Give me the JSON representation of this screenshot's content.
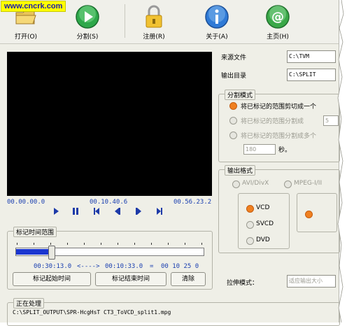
{
  "watermark": "www.cncrk.com",
  "toolbar": {
    "open": "打开(O)",
    "split": "分割(S)",
    "register": "注册(R)",
    "about": "关于(A)",
    "home": "主页(H)"
  },
  "player": {
    "time_start": "00.00.00.0",
    "time_current": "00.10.40.6",
    "time_end": "00.56.23.2"
  },
  "mark_range": {
    "title": "标记时间范围",
    "start": "00:30:13.0",
    "arrow": "<---->",
    "end": "00:10:33.0",
    "equals": "=",
    "duration": "00 10 25 0",
    "btn_mark_start": "标记起始时间",
    "btn_mark_end": "标记结束时间",
    "btn_clear": "清除",
    "position_fraction": 0.19
  },
  "files": {
    "source_label": "来源文件",
    "source_value": "C:\\TVM",
    "output_label": "输出目录",
    "output_value": "C:\\SPLIT"
  },
  "split_mode": {
    "title": "分割模式",
    "opt1": "将已标记的范围剪切成一个",
    "opt2": "将已标记的范围分割成",
    "opt2_value": "5",
    "opt3": "将已标记的范围分割成多个",
    "opt3_value": "180",
    "seconds": "秒。"
  },
  "output_format": {
    "title": "输出格式",
    "avi": "AVI/DivX",
    "mpeg": "MPEG-I/II",
    "vcd": "VCD",
    "svcd": "SVCD",
    "dvd": "DVD"
  },
  "stretch": {
    "label": "拉伸模式：",
    "value": "适应输出大小"
  },
  "processing": {
    "title": "正在处理",
    "text": "C:\\SPLIT_OUTPUT\\SPR-HcgHsT CT3_ToVCD_split1.mpg"
  },
  "colors": {
    "accent_blue": "#1a3fb0",
    "radio_selected": "#f08020",
    "slider_fill": "#1b36d0",
    "watermark_bg": "#ffff00"
  }
}
